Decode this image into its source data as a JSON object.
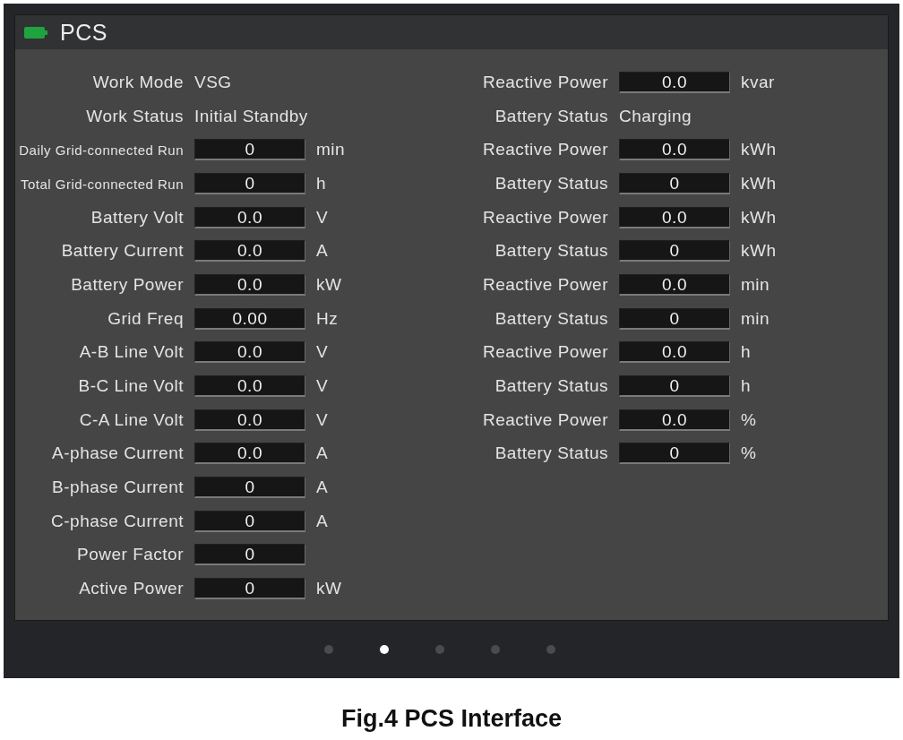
{
  "window": {
    "title": "PCS"
  },
  "left_fields": [
    {
      "kind": "text",
      "label": "Work Mode",
      "value": "VSG"
    },
    {
      "kind": "text",
      "label": "Work Status",
      "value": "Initial Standby"
    },
    {
      "kind": "box",
      "label": "Daily Grid-connected Run",
      "value": "0",
      "unit": "min"
    },
    {
      "kind": "box",
      "label": "Total Grid-connected Run",
      "value": "0",
      "unit": "h"
    },
    {
      "kind": "box",
      "label": "Battery Volt",
      "value": "0.0",
      "unit": "V"
    },
    {
      "kind": "box",
      "label": "Battery Current",
      "value": "0.0",
      "unit": "A"
    },
    {
      "kind": "box",
      "label": "Battery Power",
      "value": "0.0",
      "unit": "kW"
    },
    {
      "kind": "box",
      "label": "Grid Freq",
      "value": "0.00",
      "unit": "Hz"
    },
    {
      "kind": "box",
      "label": "A-B Line Volt",
      "value": "0.0",
      "unit": "V"
    },
    {
      "kind": "box",
      "label": "B-C Line Volt",
      "value": "0.0",
      "unit": "V"
    },
    {
      "kind": "box",
      "label": "C-A Line Volt",
      "value": "0.0",
      "unit": "V"
    },
    {
      "kind": "box",
      "label": "A-phase Current",
      "value": "0.0",
      "unit": "A"
    },
    {
      "kind": "box",
      "label": "B-phase Current",
      "value": "0",
      "unit": "A"
    },
    {
      "kind": "box",
      "label": "C-phase Current",
      "value": "0",
      "unit": "A"
    },
    {
      "kind": "box",
      "label": "Power Factor",
      "value": "0"
    },
    {
      "kind": "box",
      "label": "Active Power",
      "value": "0",
      "unit": "kW"
    }
  ],
  "right_fields": [
    {
      "kind": "box",
      "label": "Reactive Power",
      "value": "0.0",
      "unit": "kvar"
    },
    {
      "kind": "text",
      "label": "Battery Status",
      "value": "Charging"
    },
    {
      "kind": "box",
      "label": "Reactive Power",
      "value": "0.0",
      "unit": "kWh"
    },
    {
      "kind": "box",
      "label": "Battery Status",
      "value": "0",
      "unit": "kWh"
    },
    {
      "kind": "box",
      "label": "Reactive Power",
      "value": "0.0",
      "unit": "kWh"
    },
    {
      "kind": "box",
      "label": "Battery Status",
      "value": "0",
      "unit": "kWh"
    },
    {
      "kind": "box",
      "label": "Reactive Power",
      "value": "0.0",
      "unit": "min"
    },
    {
      "kind": "box",
      "label": "Battery Status",
      "value": "0",
      "unit": "min"
    },
    {
      "kind": "box",
      "label": "Reactive Power",
      "value": "0.0",
      "unit": "h"
    },
    {
      "kind": "box",
      "label": "Battery Status",
      "value": "0",
      "unit": "h"
    },
    {
      "kind": "box",
      "label": "Reactive Power",
      "value": "0.0",
      "unit": "%"
    },
    {
      "kind": "box",
      "label": "Battery Status",
      "value": "0",
      "unit": "%"
    }
  ],
  "pages": [
    {
      "selected": false
    },
    {
      "selected": true
    },
    {
      "selected": false
    },
    {
      "selected": false
    },
    {
      "selected": false
    }
  ],
  "caption": "Fig.4 PCS Interface"
}
